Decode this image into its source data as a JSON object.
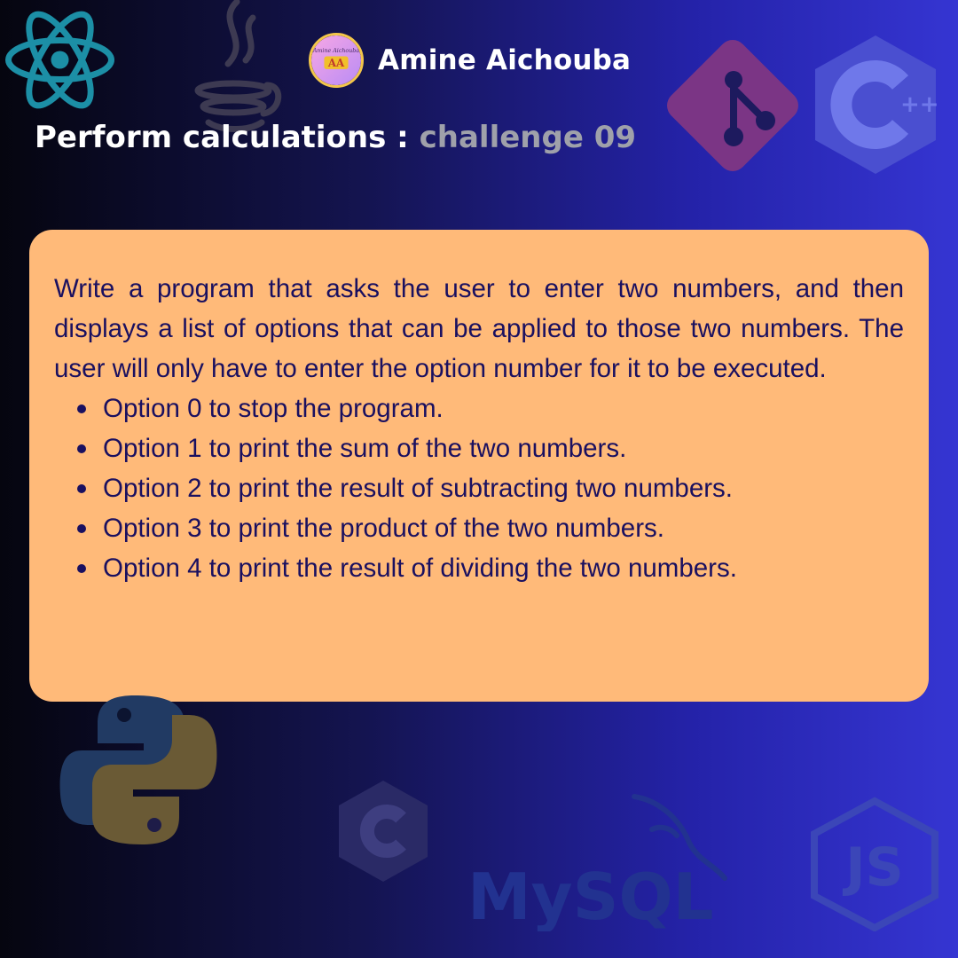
{
  "header": {
    "author": "Amine Aichouba",
    "avatar_text": "AA",
    "avatar_caption": "Amine Aichouba"
  },
  "title": {
    "main": "Perform calculations :",
    "sub": "challenge 09"
  },
  "card": {
    "intro": "Write a program that asks the user to enter two numbers, and then displays a list of options that can be applied to those two numbers. The user will only have to enter the option number for it to be executed.",
    "options": [
      "Option 0 to stop the program.",
      "Option 1 to print the sum of the two numbers.",
      "Option 2 to print the result of subtracting two numbers.",
      "Option 3 to print the product of the two numbers.",
      "Option 4 to print the result of dividing the two numbers."
    ]
  },
  "background_logos": {
    "react": "react-icon",
    "java": "java-icon",
    "git": "git-icon",
    "cpp": "cpp-icon",
    "cpp_text": "++",
    "python": "python-icon",
    "c": "c-icon",
    "mysql": "mysql-icon",
    "mysql_text": "MySQL",
    "nodejs": "nodejs-icon",
    "nodejs_text": "JS"
  },
  "colors": {
    "card": "#ffba79",
    "card_text": "#1a1060",
    "title": "#ffffff",
    "title_sub": "#9fa1aa",
    "react": "#1c8fa6",
    "git": "#7b3585",
    "cpp": "#4a4fd0",
    "python_blue": "#213a63",
    "python_yellow": "#6a5a35"
  }
}
